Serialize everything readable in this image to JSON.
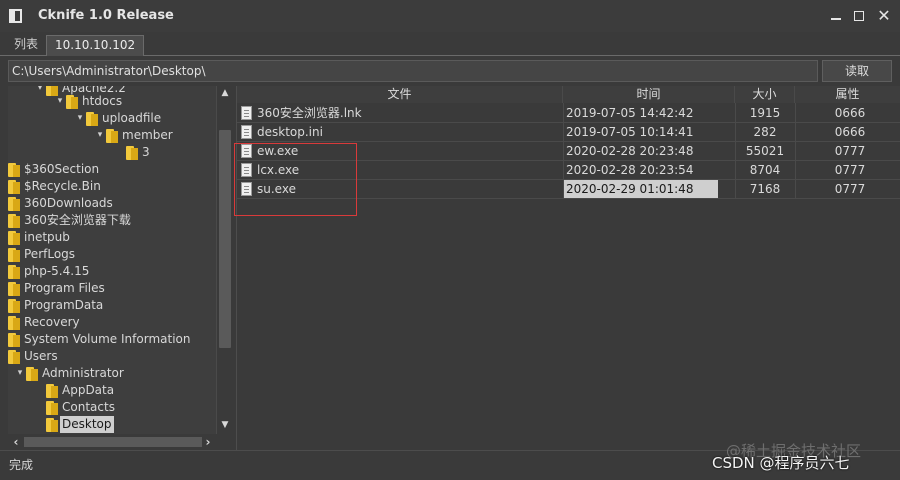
{
  "window": {
    "title": "Cknife 1.0 Release"
  },
  "tabs": [
    {
      "label": "列表"
    },
    {
      "label": "10.10.10.102"
    }
  ],
  "pathbar": {
    "path": "C:\\Users\\Administrator\\Desktop\\",
    "read_label": "读取"
  },
  "tree": {
    "items": [
      {
        "label": "Apache2.2",
        "twisty": "▾"
      },
      {
        "label": "htdocs",
        "twisty": "▾"
      },
      {
        "label": "uploadfile",
        "twisty": "▾"
      },
      {
        "label": "member",
        "twisty": "▾"
      },
      {
        "label": "3",
        "twisty": ""
      },
      {
        "label": "$360Section",
        "twisty": ""
      },
      {
        "label": "$Recycle.Bin",
        "twisty": ""
      },
      {
        "label": "360Downloads",
        "twisty": ""
      },
      {
        "label": "360安全浏览器下载",
        "twisty": ""
      },
      {
        "label": "inetpub",
        "twisty": ""
      },
      {
        "label": "PerfLogs",
        "twisty": ""
      },
      {
        "label": "php-5.4.15",
        "twisty": ""
      },
      {
        "label": "Program Files",
        "twisty": ""
      },
      {
        "label": "ProgramData",
        "twisty": ""
      },
      {
        "label": "Recovery",
        "twisty": ""
      },
      {
        "label": "System Volume Information",
        "twisty": ""
      },
      {
        "label": "Users",
        "twisty": ""
      },
      {
        "label": "Administrator",
        "twisty": "▾"
      },
      {
        "label": "AppData",
        "twisty": ""
      },
      {
        "label": "Contacts",
        "twisty": ""
      },
      {
        "label": "Desktop",
        "twisty": ""
      }
    ]
  },
  "files": {
    "headers": {
      "name": "文件",
      "time": "时间",
      "size": "大小",
      "attr": "属性"
    },
    "rows": [
      {
        "name": "360安全浏览器.lnk",
        "time": "2019-07-05 14:42:42",
        "size": "1915",
        "attr": "0666"
      },
      {
        "name": "desktop.ini",
        "time": "2019-07-05 10:14:41",
        "size": "282",
        "attr": "0666"
      },
      {
        "name": "ew.exe",
        "time": "2020-02-28 20:23:48",
        "size": "55021",
        "attr": "0777"
      },
      {
        "name": "lcx.exe",
        "time": "2020-02-28 20:23:54",
        "size": "8704",
        "attr": "0777"
      },
      {
        "name": "su.exe",
        "time": "2020-02-29 01:01:48",
        "size": "7168",
        "attr": "0777"
      }
    ]
  },
  "status": {
    "text": "完成"
  },
  "watermark": {
    "line1": "@稀土掘金技术社区",
    "line2": "CSDN @程序员六七"
  },
  "colors": {
    "background": "#3a3a3a",
    "highlight_box": "#d93a3a",
    "selection": "#cfcfcf",
    "folder": "#f2c93c"
  }
}
